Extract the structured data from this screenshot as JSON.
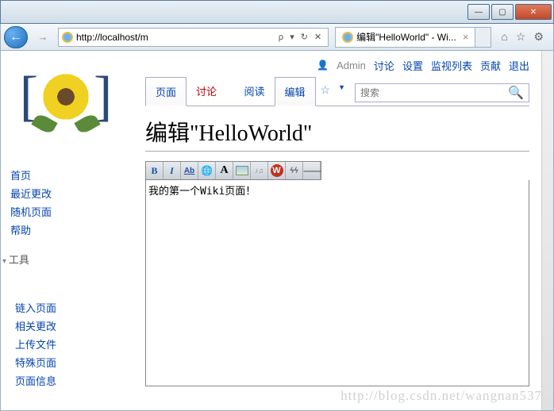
{
  "browser": {
    "url": "http://localhost/m",
    "search_hint": "ρ",
    "tab_title": "编辑\"HelloWorld\" - Wi...",
    "navicons": {
      "home": "⌂",
      "fav": "☆",
      "gear": "⚙"
    }
  },
  "user": {
    "name": "Admin",
    "links": {
      "talk": "讨论",
      "prefs": "设置",
      "watch": "监视列表",
      "contrib": "贡献",
      "logout": "退出"
    }
  },
  "tabs": {
    "page": "页面",
    "talk": "讨论",
    "read": "阅读",
    "edit": "编辑"
  },
  "search": {
    "placeholder": "搜索"
  },
  "title": "编辑\"HelloWorld\"",
  "toolbar": {
    "b": "B",
    "i": "I",
    "ab": "Ab",
    "globe": "🌐",
    "a2": "A",
    "media": "♪♫",
    "sig": "ϟϟ",
    "hr": "——"
  },
  "editor": {
    "content": "我的第一个Wiki页面！"
  },
  "sidebar": {
    "nav": {
      "main": "首页",
      "recent": "最近更改",
      "random": "随机页面",
      "help": "帮助"
    },
    "tools_hdr": "工具",
    "tools": {
      "links": "链入页面",
      "related": "相关更改",
      "upload": "上传文件",
      "special": "特殊页面",
      "info": "页面信息"
    }
  },
  "watermark": "http://blog.csdn.net/wangnan537"
}
